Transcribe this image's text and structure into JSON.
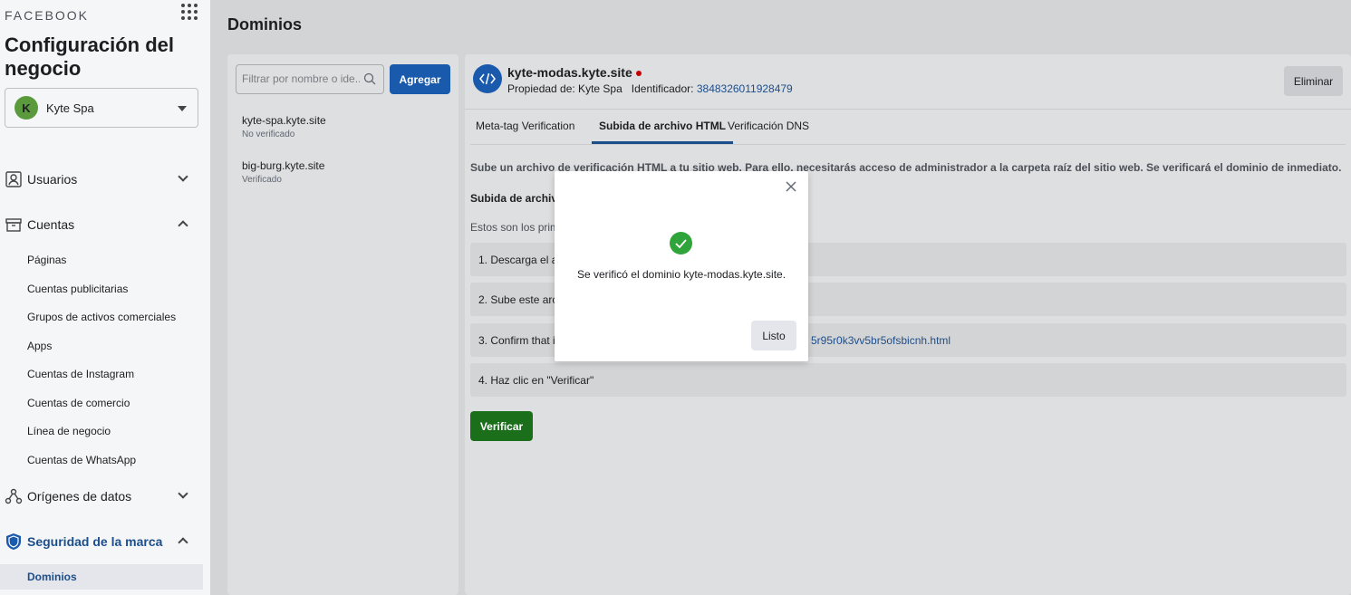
{
  "sidebar": {
    "brand": "FACEBOOK",
    "title": "Configuración del negocio",
    "account": {
      "initial": "K",
      "name": "Kyte Spa"
    },
    "sections": {
      "users": "Usuarios",
      "accounts": "Cuentas",
      "data_sources": "Orígenes de datos",
      "brand_safety": "Seguridad de la marca"
    },
    "accounts_items": [
      "Páginas",
      "Cuentas publicitarias",
      "Grupos de activos comerciales",
      "Apps",
      "Cuentas de Instagram",
      "Cuentas de comercio",
      "Línea de negocio",
      "Cuentas de WhatsApp"
    ],
    "active_item": "Dominios"
  },
  "page": {
    "title": "Dominios"
  },
  "list": {
    "search_placeholder": "Filtrar por nombre o ide...",
    "add_label": "Agregar",
    "domains": [
      {
        "name": "kyte-spa.kyte.site",
        "status": "No verificado"
      },
      {
        "name": "big-burg.kyte.site",
        "status": "Verificado"
      }
    ]
  },
  "detail": {
    "domain": "kyte-modas.kyte.site",
    "owner_label": "Propiedad de: Kyte Spa",
    "id_label": "Identificador:",
    "id_value": "3848326011928479",
    "delete_label": "Eliminar",
    "tabs": [
      "Meta-tag Verification",
      "Subida de archivo HTML",
      "Verificación DNS"
    ],
    "intro": "Sube un archivo de verificación HTML a tu sitio web. Para ello, necesitarás acceso de administrador a la carpeta raíz del sitio web. Se verificará el dominio de inmediato.",
    "section_title": "Subida de archivo",
    "steps_intro": "Estos son los prim",
    "steps": [
      "1. Descarga el ar",
      "2. Sube este arch",
      "3. Confirm that it",
      "4. Haz clic en \"Verificar\""
    ],
    "file_link": "5r95r0k3vv5br5ofsbicnh.html",
    "verify_label": "Verificar"
  },
  "modal": {
    "message": "Se verificó el dominio kyte-modas.kyte.site.",
    "done_label": "Listo"
  },
  "colors": {
    "primary": "#1a5aad",
    "link": "#1d4e8c",
    "success": "#2ea43a",
    "verify": "#1b6f1b",
    "error_dot": "#c40000"
  }
}
